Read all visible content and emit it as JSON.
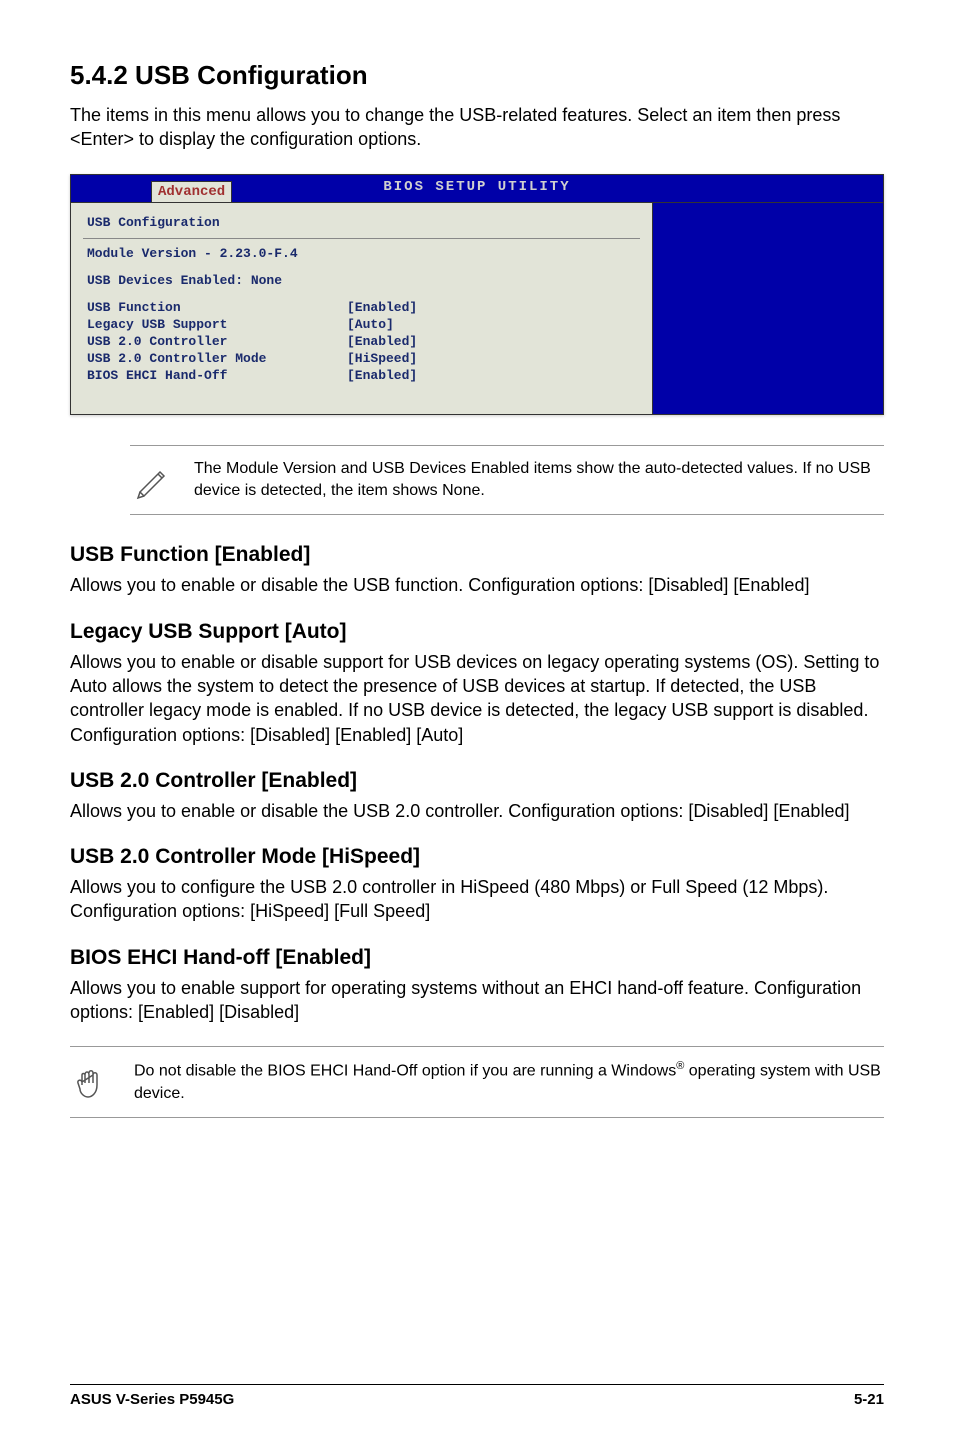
{
  "section": {
    "number_title": "5.4.2   USB Configuration",
    "intro": "The items in this menu allows you to change the USB-related features. Select an item then press <Enter> to display the configuration options."
  },
  "bios": {
    "title": "BIOS SETUP UTILITY",
    "tab": "Advanced",
    "panel_title": "USB Configuration",
    "module_version": "Module Version - 2.23.0-F.4",
    "devices_enabled": "USB Devices Enabled: None",
    "rows": [
      {
        "label": "USB Function",
        "value": "[Enabled]"
      },
      {
        "label": "Legacy USB Support",
        "value": "[Auto]"
      },
      {
        "label": "USB 2.0 Controller",
        "value": "[Enabled]"
      },
      {
        "label": "USB 2.0 Controller Mode",
        "value": "[HiSpeed]"
      },
      {
        "label": "BIOS EHCI Hand-Off",
        "value": "[Enabled]"
      }
    ]
  },
  "note1": "The Module Version and USB Devices Enabled items show the auto-detected values. If no USB device is detected, the item shows None.",
  "subs": {
    "usb_function": {
      "title": "USB Function [Enabled]",
      "body": "Allows you to enable or disable the USB function. Configuration options: [Disabled] [Enabled]"
    },
    "legacy": {
      "title": "Legacy USB Support [Auto]",
      "body": "Allows you to enable or disable support for USB devices on legacy operating systems (OS). Setting to Auto allows the system to detect the presence of USB devices at startup. If detected, the USB controller legacy mode is enabled. If no USB device is detected, the legacy USB support is disabled. Configuration options: [Disabled] [Enabled] [Auto]"
    },
    "usb20": {
      "title": "USB 2.0 Controller [Enabled]",
      "body": "Allows you to enable or disable the USB 2.0 controller. Configuration options: [Disabled] [Enabled]"
    },
    "usb20mode": {
      "title": "USB 2.0 Controller Mode [HiSpeed]",
      "body": "Allows you to configure the USB 2.0 controller in HiSpeed (480 Mbps) or Full Speed (12 Mbps). Configuration options: [HiSpeed] [Full Speed]"
    },
    "ehci": {
      "title": "BIOS EHCI Hand-off [Enabled]",
      "body": "Allows you to enable support for operating systems without an EHCI hand-off feature. Configuration options: [Enabled] [Disabled]"
    }
  },
  "note2_a": "Do not disable the BIOS EHCI Hand-Off option if you are running a Windows",
  "note2_b": " operating system with USB device.",
  "note2_sup": "®",
  "footer": {
    "left": "ASUS V-Series P5945G",
    "right": "5-21"
  }
}
